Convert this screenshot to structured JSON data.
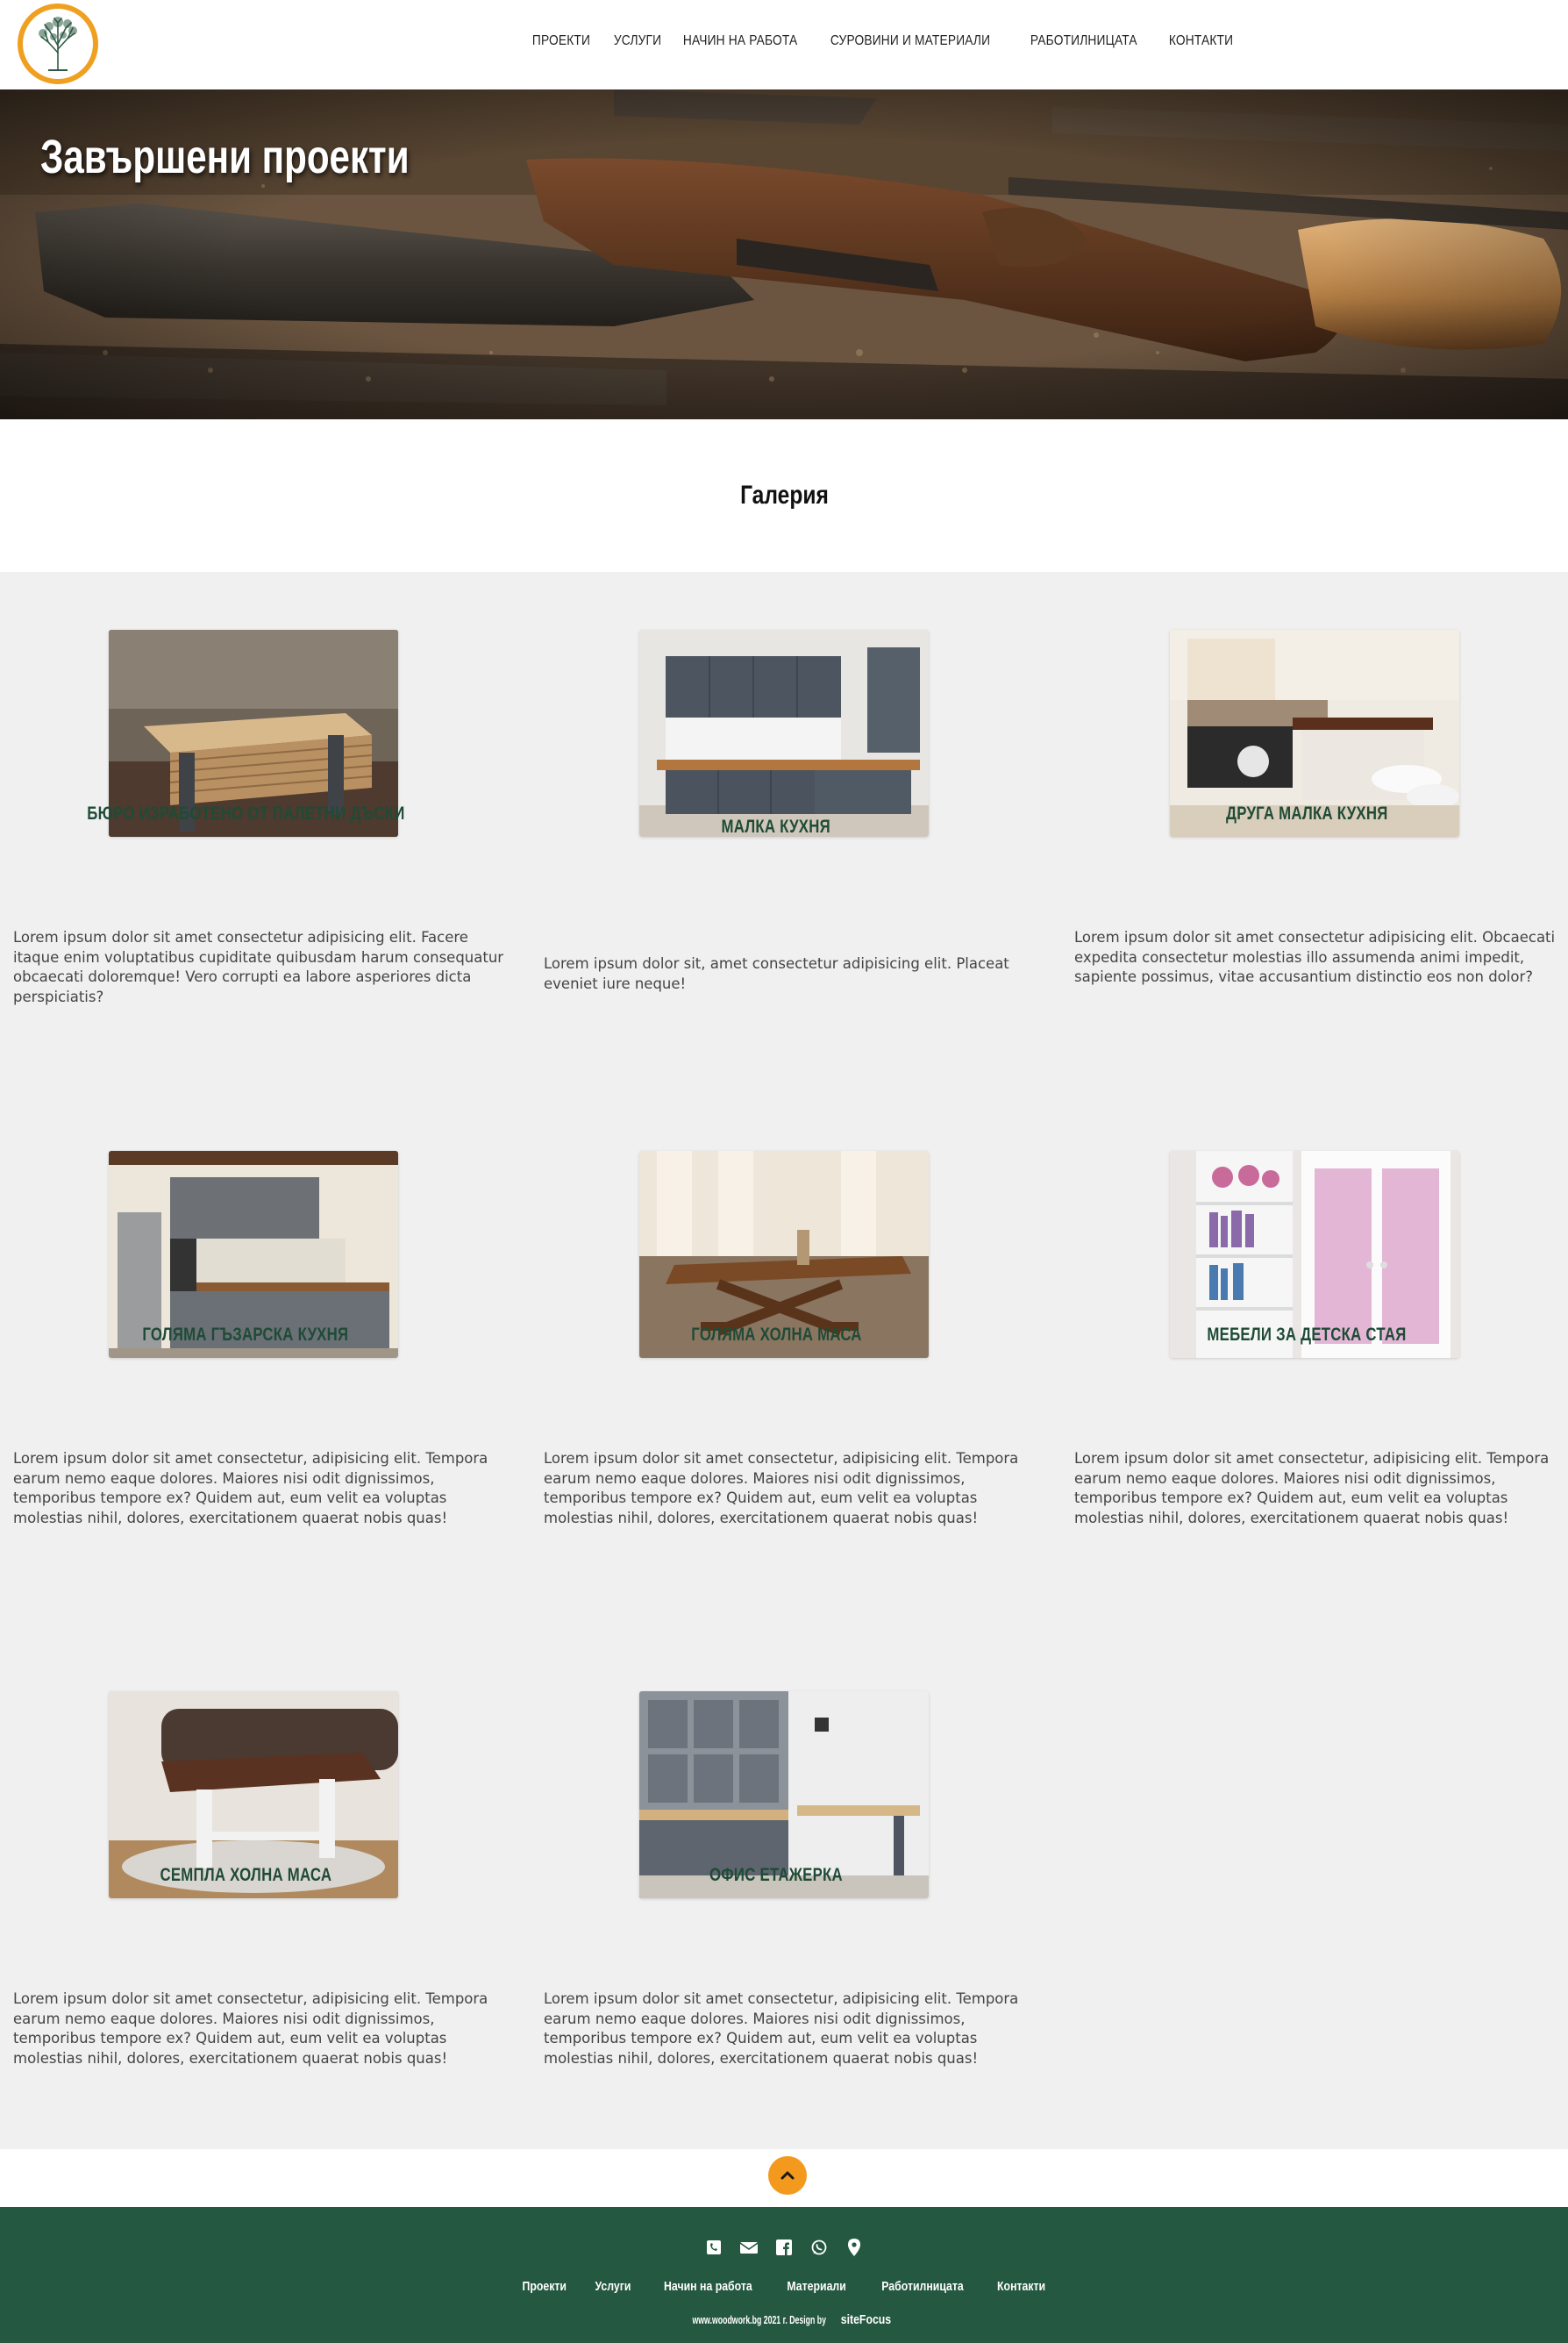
{
  "nav": {
    "items": [
      "ПРОЕКТИ",
      "УСЛУГИ",
      "НАЧИН НА РАБОТА",
      "СУРОВИНИ И МАТЕРИАЛИ",
      "РАБОТИЛНИЦАТА",
      "КОНТАКТИ"
    ]
  },
  "logo": {
    "icon": "tree-logo-icon",
    "accent": "#f0a020",
    "tree_color": "#2e5a45"
  },
  "hero": {
    "title": "Завършени проекти"
  },
  "gallery": {
    "heading": "Галерия",
    "cards": [
      {
        "title": "БЮРО ИЗРАБОТЕНО ОТ ПАЛЕТНИ ДЪСКИ",
        "text": "Lorem ipsum dolor sit amet consectetur adipisicing elit. Facere itaque enim voluptatibus cupiditate quibusdam harum consequatur obcaecati doloremque! Vero corrupti ea labore asperiores dicta perspiciatis?"
      },
      {
        "title": "МАЛКА КУХНЯ",
        "text": "Lorem ipsum dolor sit, amet consectetur adipisicing elit. Placeat eveniet iure neque!"
      },
      {
        "title": "ДРУГА МАЛКА КУХНЯ",
        "text": "Lorem ipsum dolor sit amet consectetur adipisicing elit. Obcaecati expedita consectetur molestias illo assumenda animi impedit, sapiente possimus, vitae accusantium distinctio eos non dolor?"
      },
      {
        "title": "ГОЛЯМА ГЪЗАРСКА КУХНЯ",
        "text": "Lorem ipsum dolor sit amet consectetur, adipisicing elit. Tempora earum nemo eaque dolores. Maiores nisi odit dignissimos, temporibus tempore ex? Quidem aut, eum velit ea voluptas molestias nihil, dolores, exercitationem quaerat nobis quas!"
      },
      {
        "title": "ГОЛЯМА ХОЛНА МАСА",
        "text": "Lorem ipsum dolor sit amet consectetur, adipisicing elit. Tempora earum nemo eaque dolores. Maiores nisi odit dignissimos, temporibus tempore ex? Quidem aut, eum velit ea voluptas molestias nihil, dolores, exercitationem quaerat nobis quas!"
      },
      {
        "title": "МЕБЕЛИ ЗА ДЕТСКА СТАЯ",
        "text": "Lorem ipsum dolor sit amet consectetur, adipisicing elit. Tempora earum nemo eaque dolores. Maiores nisi odit dignissimos, temporibus tempore ex? Quidem aut, eum velit ea voluptas molestias nihil, dolores, exercitationem quaerat nobis quas!"
      },
      {
        "title": "СЕМПЛА ХОЛНА МАСА",
        "text": "Lorem ipsum dolor sit amet consectetur, adipisicing elit. Tempora earum nemo eaque dolores. Maiores nisi odit dignissimos, temporibus tempore ex? Quidem aut, eum velit ea voluptas molestias nihil, dolores, exercitationem quaerat nobis quas!"
      },
      {
        "title": "ОФИС ЕТАЖЕРКА",
        "text": "Lorem ipsum dolor sit amet consectetur, adipisicing elit. Tempora earum nemo eaque dolores. Maiores nisi odit dignissimos, temporibus tempore ex? Quidem aut, eum velit ea voluptas molestias nihil, dolores, exercitationem quaerat nobis quas!"
      }
    ]
  },
  "back_to_top": {
    "icon": "chevron-up-icon",
    "color": "#f39a1e"
  },
  "footer": {
    "background": "#245841",
    "icons": [
      "phone-icon",
      "email-icon",
      "facebook-icon",
      "whatsapp-icon",
      "location-icon"
    ],
    "links": [
      "Проекти",
      "Услуги",
      "Начин на работа",
      "Материали",
      "Работилницата",
      "Контакти"
    ],
    "copyright_prefix": "www.woodwork.bg 2021 г. Design by ",
    "copyright_brand": "siteFocus"
  }
}
